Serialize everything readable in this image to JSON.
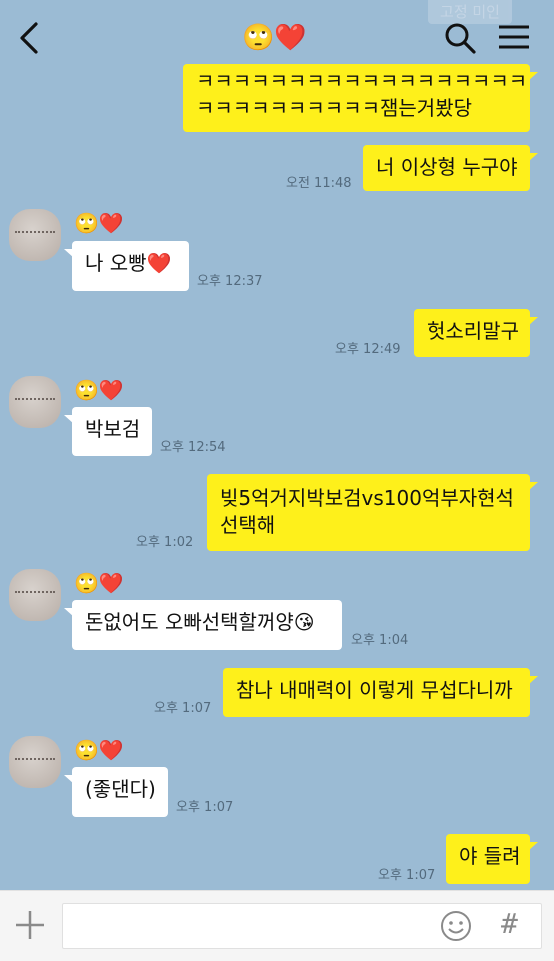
{
  "header": {
    "title_emoji": "🙄❤️",
    "faded_label": "고정 미인"
  },
  "messages": [
    {
      "side": "me",
      "text_line1": "ㅋㅋㅋㅋㅋㅋㅋㅋㅋㅋㅋㅋㅋㅋㅋㅋㅋㅋ",
      "text_line2": "ㅋㅋㅋㅋㅋㅋㅋㅋㅋㅋ잼는거봤당",
      "time": ""
    },
    {
      "side": "me",
      "text": "너 이상형 누구야",
      "time": "오전 11:48"
    },
    {
      "side": "them",
      "name": "🙄❤️",
      "text": "나 오빵❤️",
      "time": "오후 12:37"
    },
    {
      "side": "me",
      "text": "헛소리말구",
      "time": "오후 12:49"
    },
    {
      "side": "them",
      "name": "🙄❤️",
      "text": "박보검",
      "time": "오후 12:54"
    },
    {
      "side": "me",
      "text_line1": "빚5억거지박보검vs100억부자현석",
      "text_line2": "선택해",
      "time": "오후 1:02"
    },
    {
      "side": "them",
      "name": "🙄❤️",
      "text": "돈없어도 오빠선택할꺼양😘",
      "time": "오후 1:04"
    },
    {
      "side": "me",
      "text": "참나 내매력이 이렇게 무섭다니까",
      "time": "오후 1:07"
    },
    {
      "side": "them",
      "name": "🙄❤️",
      "text": "(좋댄다)",
      "time": "오후 1:07"
    },
    {
      "side": "me",
      "text": "야 들려",
      "time": "오후 1:07"
    }
  ],
  "input": {
    "placeholder": "",
    "hash_label": "#"
  },
  "colors": {
    "background": "#9bbbd4",
    "my_bubble": "#fef01b",
    "their_bubble": "#ffffff"
  },
  "icons": [
    "back-arrow-icon",
    "search-icon",
    "menu-icon",
    "plus-icon",
    "emoji-icon",
    "hash-icon"
  ]
}
